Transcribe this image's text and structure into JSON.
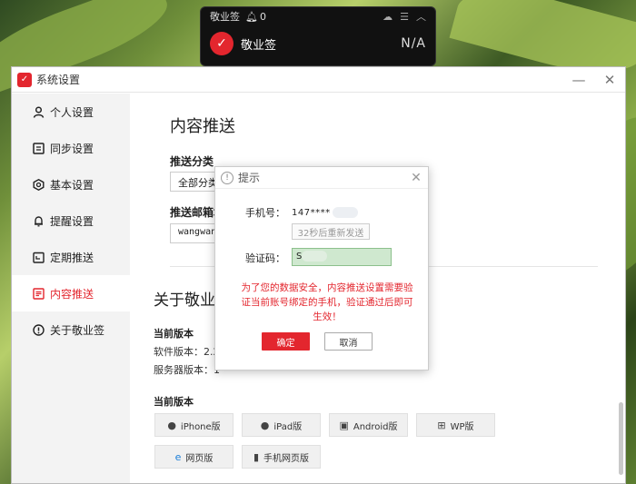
{
  "widget": {
    "title": "敬业签",
    "bell_count": "0",
    "name": "敬业签",
    "value": "N/A"
  },
  "window": {
    "title": "系统设置"
  },
  "sidebar": {
    "items": [
      {
        "label": "个人设置",
        "icon": "user-icon"
      },
      {
        "label": "同步设置",
        "icon": "sync-icon"
      },
      {
        "label": "基本设置",
        "icon": "settings-icon"
      },
      {
        "label": "提醒设置",
        "icon": "bell-icon"
      },
      {
        "label": "定期推送",
        "icon": "calendar-icon"
      },
      {
        "label": "内容推送",
        "icon": "document-icon"
      },
      {
        "label": "关于敬业签",
        "icon": "info-icon"
      }
    ],
    "active_index": 5
  },
  "main": {
    "section_title": "内容推送",
    "push_category_label": "推送分类",
    "push_category_value": "全部分类",
    "push_email_label": "推送邮箱地",
    "push_email_value": "wangwang",
    "about_title": "关于敬业",
    "current_version_label": "当前版本",
    "software_version_label": "软件版本：2.2",
    "server_version_label": "服务器版本：1",
    "versions_label": "当前版本",
    "version_buttons": [
      {
        "label": "iPhone版",
        "icon": "apple-icon"
      },
      {
        "label": "iPad版",
        "icon": "apple-icon"
      },
      {
        "label": "Android版",
        "icon": "android-icon"
      },
      {
        "label": "WP版",
        "icon": "windows-icon"
      },
      {
        "label": "网页版",
        "icon": "ie-icon"
      },
      {
        "label": "手机网页版",
        "icon": "phone-icon"
      }
    ]
  },
  "dialog": {
    "title": "提示",
    "phone_label": "手机号：",
    "phone_value": "147****",
    "resend_label": "32秒后重新发送",
    "code_label": "验证码：",
    "code_value": "S",
    "warning": "为了您的数据安全，内容推送设置需要验证当前账号绑定的手机，验证通过后即可生效！",
    "ok_label": "确定",
    "cancel_label": "取消"
  },
  "colors": {
    "accent": "#e3262e",
    "input_highlight": "#cfe8cf"
  }
}
